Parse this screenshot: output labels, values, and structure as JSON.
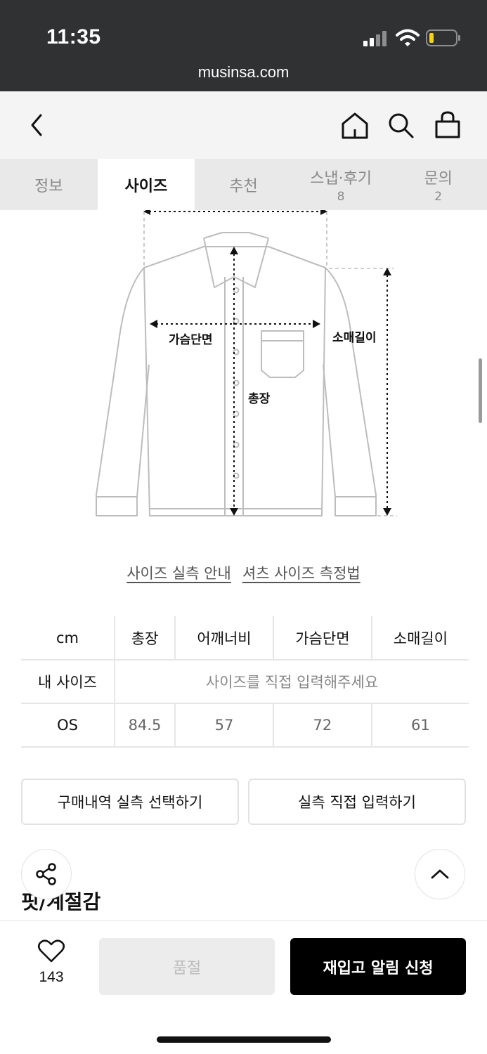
{
  "status": {
    "time": "11:35",
    "url": "musinsa.com"
  },
  "tabs": [
    {
      "label": "정보",
      "count": ""
    },
    {
      "label": "사이즈",
      "count": ""
    },
    {
      "label": "추천",
      "count": ""
    },
    {
      "label": "스냅·후기",
      "count": "8"
    },
    {
      "label": "문의",
      "count": "2"
    }
  ],
  "active_tab": "사이즈",
  "diagram": {
    "labels": {
      "chest": "가슴단면",
      "length": "총장",
      "sleeve": "소매길이"
    }
  },
  "guides": {
    "size_guide": "사이즈 실측 안내",
    "shirt_measure": "셔츠 사이즈 측정법"
  },
  "size_table": {
    "unit": "cm",
    "headers": [
      "총장",
      "어깨너비",
      "가슴단면",
      "소매길이"
    ],
    "my_size_label": "내 사이즈",
    "my_size_prompt": "사이즈를 직접 입력해주세요",
    "rows": [
      {
        "size": "OS",
        "values": [
          "84.5",
          "57",
          "72",
          "61"
        ]
      }
    ]
  },
  "buttons": {
    "select_purchase": "구매내역 실측 선택하기",
    "direct_input": "실측 직접 입력하기"
  },
  "section_title": "핏/계절감",
  "bottom": {
    "like_count": "143",
    "soldout_label": "품절",
    "restock_label": "재입고 알림 신청"
  },
  "icons": {
    "back": "chevron-left-icon",
    "home": "home-icon",
    "search": "search-icon",
    "cart": "bag-icon",
    "share": "share-icon",
    "to_top": "chevron-up-icon",
    "like": "heart-icon"
  },
  "colors": {
    "status_bar": "#2f3133",
    "header_bg": "#f4f4f4",
    "tabs_bg": "#e9e9e9",
    "battery_low": "#f5d418",
    "restock_bg": "#000000"
  }
}
